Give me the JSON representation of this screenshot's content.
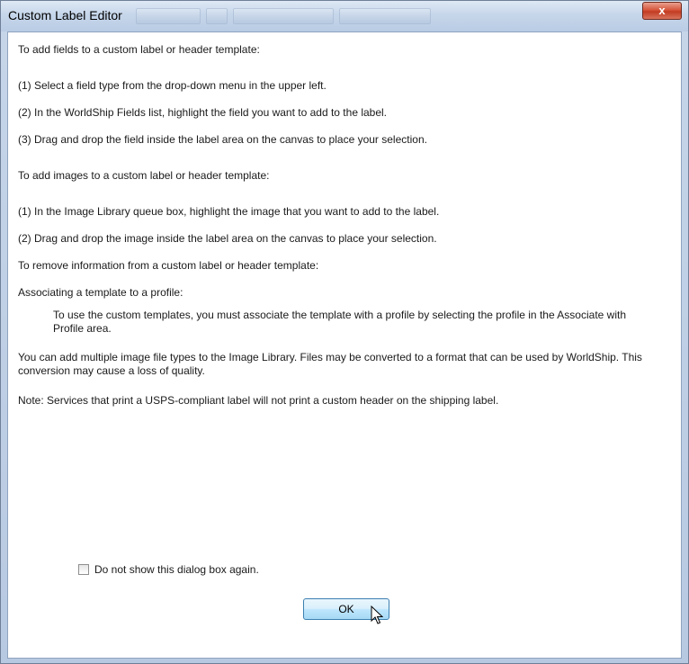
{
  "window": {
    "title": "Custom Label Editor",
    "close_glyph": "x"
  },
  "content": {
    "fields_heading": "To add fields to a custom label or header template:",
    "fields_step1": "(1) Select a field type from the drop-down menu in the upper left.",
    "fields_step2": "(2) In the WorldShip Fields list, highlight the field you want to add to the label.",
    "fields_step3": "(3) Drag and drop the field inside the label area on the canvas to place your selection.",
    "images_heading": "To add images to a custom label or header template:",
    "images_step1": "(1) In the Image Library queue box, highlight the image that you want to add to the label.",
    "images_step2": "(2) Drag and drop the image inside the label area on the canvas to place your selection.",
    "remove_heading": "To remove information from a custom label or header template:",
    "associate_heading": "Associating a template to a profile:",
    "associate_body": "To use the custom templates, you must associate the template with a profile by selecting the profile in the Associate with Profile area.",
    "image_types_note": "You can add multiple image file types to the Image Library. Files may be converted to a format that can be used by WorldShip. This conversion may cause a loss of quality.",
    "usps_note": "Note: Services that print a USPS-compliant label will not print a custom header on the shipping label."
  },
  "footer": {
    "dont_show_label": "Do not show this dialog box again.",
    "dont_show_checked": false,
    "ok_label": "OK"
  },
  "icons": {
    "close": "close-icon",
    "cursor": "mouse-pointer-icon"
  },
  "colors": {
    "title_bar": "#c6d6ea",
    "close_button": "#c23c22",
    "ok_button": "#bee6fd"
  }
}
